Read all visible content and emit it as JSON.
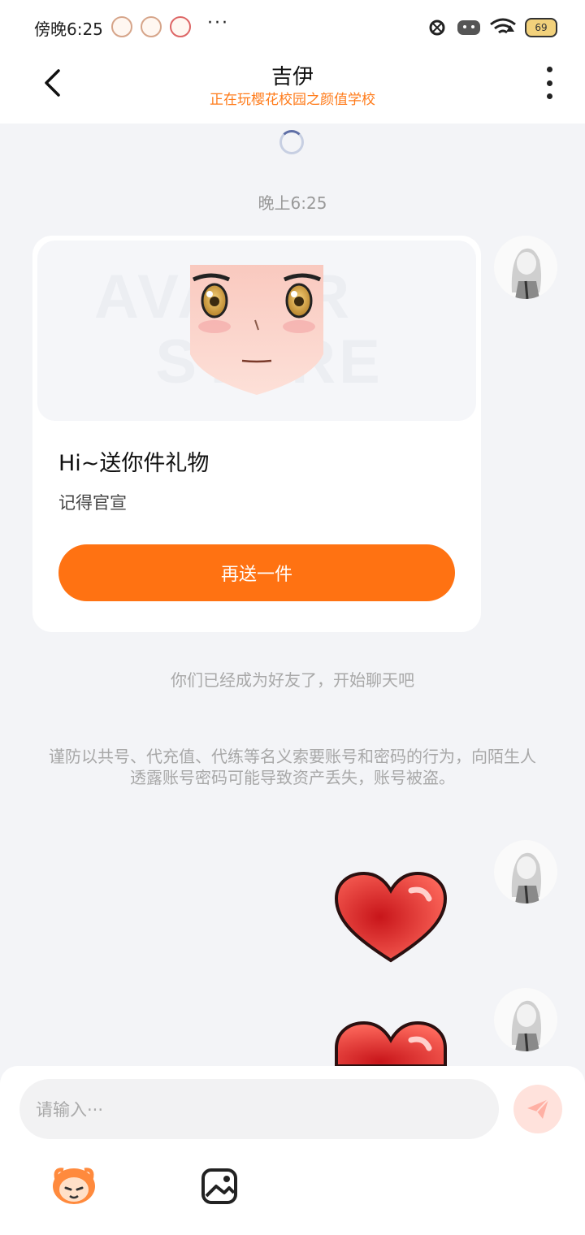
{
  "status": {
    "time": "傍晚6:25",
    "battery": "69",
    "more": "···"
  },
  "header": {
    "title": "吉伊",
    "subtitle": "正在玩樱花校园之颜值学校"
  },
  "chat": {
    "timestamp": "晚上6:25",
    "gift_card": {
      "title": "Hi~送你件礼物",
      "desc": "记得官宣",
      "button": "再送一件"
    },
    "system_friend": "你们已经成为好友了，开始聊天吧",
    "system_warning": "谨防以共号、代充值、代练等名义索要账号和密码的行为，向陌生人透露账号密码可能导致资产丢失，账号被盗。"
  },
  "input": {
    "placeholder": "请输入···"
  },
  "colors": {
    "accent": "#ff7212",
    "subtitle": "#ff7b1a",
    "background": "#f3f4f7"
  }
}
